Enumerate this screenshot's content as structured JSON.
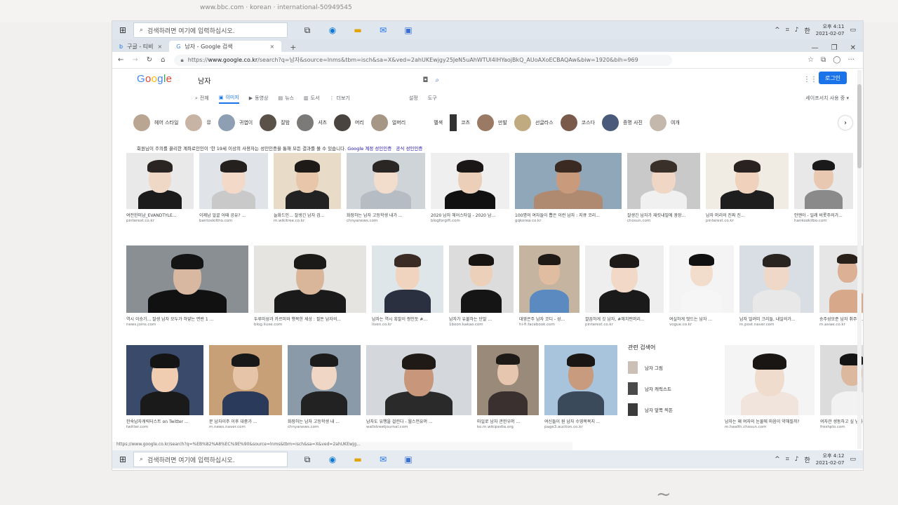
{
  "paper": {
    "snippet": "www.bbc.com · korean · international-50949545"
  },
  "taskbar": {
    "search_placeholder": "검색하려면 여기에 입력하십시오.",
    "ime": "한",
    "clock_time": "오후 4:11",
    "clock_date": "2021-02-07",
    "bottom_clock_time": "오후 4:12",
    "bottom_clock_date": "2021-02-07"
  },
  "browser": {
    "tabs": [
      {
        "label": "구글 - 티비"
      },
      {
        "label": "남자 - Google 검색"
      }
    ],
    "url_prefix": "https://",
    "url_domain": "www.google.co.kr",
    "url_rest": "/search?q=남자&source=lnms&tbm=isch&sa=X&ved=2ahUKEwjgy25JeN5uAhWTUl4IHYaojBkQ_AUoAXoECBAQAw&biw=1920&bih=969",
    "status_url": "https://www.google.co.kr/search?q=%EB%82%A8%EC%9E%90&source=lnms&tbm=isch&sa=X&ved=2ahUKEwjg..."
  },
  "google": {
    "logo": [
      "G",
      "o",
      "o",
      "g",
      "l",
      "e"
    ],
    "query": "남자",
    "login": "로그인",
    "nav": [
      "전체",
      "이미지",
      "동영상",
      "뉴스",
      "도서",
      "더보기"
    ],
    "tools_1": "설정",
    "tools_2": "도구",
    "safesearch": "세이프서치 사용 중 ▾"
  },
  "chips": [
    {
      "label": "헤어 스타일",
      "color": "#b9a592"
    },
    {
      "label": "뮤",
      "color": "#c8b4a4"
    },
    {
      "label": "귀엽이",
      "color": "#8e9fb4"
    },
    {
      "label": "잘밤",
      "color": "#5a5148"
    },
    {
      "label": "셔츠",
      "color": "#7c7a78"
    },
    {
      "label": "머리",
      "color": "#4a4440"
    },
    {
      "label": "얼머리",
      "color": "#a59686"
    },
    {
      "label": "멜색",
      "color": "#ffffff"
    },
    {
      "label": "코츠",
      "color": "#333333"
    },
    {
      "label": "만발",
      "color": "#9a7a64"
    },
    {
      "label": "선글라스",
      "color": "#c0aa80"
    },
    {
      "label": "코스다",
      "color": "#7a5a4a"
    },
    {
      "label": "증명 사진",
      "color": "#4a5a7a"
    },
    {
      "label": "여개",
      "color": "#c4b8ac"
    }
  ],
  "notice": {
    "text": "회원님이 주의를 끌리한 계좌로인인이 '한 19세 이상의 사용자는 성인인증을 통해 모든 결과를 볼 수 있습니다.",
    "link1": "Google 계정 성인인증",
    "link2": "공식 성인인증"
  },
  "images": [
    {
      "caption": "여전한미남_EVANDTYLE...",
      "source": "pinterest.co.kr",
      "bg": "#e9e9e9",
      "skin": "#f0d8c6",
      "hair": "#2a2522",
      "top": "#1c1c1c"
    },
    {
      "caption": "이제남 얼굴 어때 공유? ...",
      "source": "bantoskiltho.com",
      "bg": "#e0e4e8",
      "skin": "#f3d9c8",
      "hair": "#24201e",
      "top": "#c9c9c9"
    },
    {
      "caption": "늘화드인... 잘생긴 남자 검...",
      "source": "m.wikitree.co.kr",
      "bg": "#e8dcc8",
      "skin": "#e8c6aa",
      "hair": "#1e1a18",
      "top": "#222222"
    },
    {
      "caption": "화장하는 남자 고등학생 내가 ...",
      "source": "chnyanews.com",
      "bg": "#cfd4d8",
      "skin": "#f2dccc",
      "hair": "#2a2624",
      "top": "#b6bcc4"
    },
    {
      "caption": "2020 남자 헤어스타일 - 2020 남...",
      "source": "blogforgift.com",
      "bg": "#efefef",
      "skin": "#eccfb8",
      "hair": "#1a1716",
      "top": "#111111"
    },
    {
      "caption": "100명의 여자들이 뽑은 이런 남자 : 지큐 코리...",
      "source": "gqkorea.co.kr",
      "bg": "#8fa7b8",
      "skin": "#c99a7c",
      "hair": "#3a2a22",
      "top": "#b08a70"
    },
    {
      "caption": "잘생긴 남자가 재킷내밀에 광장...",
      "source": "chosun.com",
      "bg": "#c9c9c9",
      "skin": "#f0d6c4",
      "hair": "#3a302a",
      "top": "#f0f0f0"
    },
    {
      "caption": "남자 머리의 진짜 진...",
      "source": "pinterest.co.kr",
      "bg": "#f0ece4",
      "skin": "#f0d2bc",
      "hair": "#2a2220",
      "top": "#1e1e1e"
    },
    {
      "caption": "안엔아 - 일레 비롯주의가...",
      "source": "hankookilbo.com",
      "bg": "#e8e8e8",
      "skin": "#e8c8b0",
      "hair": "#1a1a1a",
      "top": "#8a8a8a"
    },
    {
      "caption": "역시 이승기... 잘생 남자 모두가 하얗는 면란 1 ...",
      "source": "news.joins.com",
      "bg": "#8a8f94",
      "skin": "#d8b8a0",
      "hair": "#141414",
      "top": "#111111"
    },
    {
      "caption": "두루미성과 카르미와 행복한 세상 : 필돈 남자의...",
      "source": "blog.iluxe.com",
      "bg": "#e6e4e0",
      "skin": "#d9b69a",
      "hair": "#1c1a18",
      "top": "#1a1a1a"
    },
    {
      "caption": "남자는 역시 흑발이 짱인듯 #...",
      "source": "liven.co.kr",
      "bg": "#dfe6ea",
      "skin": "#f0d4c0",
      "hair": "#3a2c24",
      "top": "#2a3040"
    },
    {
      "caption": "남자가 유불하는 단발 ...",
      "source": "1boon.kakao.com",
      "bg": "#dcdcdc",
      "skin": "#ecd0ba",
      "hair": "#181412",
      "top": "#151515"
    },
    {
      "caption": "대영은주 남자 코디 - 성...",
      "source": "hi-fi.facebook.com",
      "bg": "#c4b4a0",
      "skin": "#e0bca0",
      "hair": "#201a16",
      "top": "#5a8ac0"
    },
    {
      "caption": "깔끔하게 깃 남자, #헤치펀머리...",
      "source": "pinterest.co.kr",
      "bg": "#eeeeee",
      "skin": "#f2d8c6",
      "hair": "#1e1a18",
      "top": "#1a1a1a"
    },
    {
      "caption": "여실하게 멋드는 남자 ...",
      "source": "vogue.co.kr",
      "bg": "#f4f4f4",
      "skin": "#f2dccc",
      "hair": "#111111",
      "top": "#f6f6f6"
    },
    {
      "caption": "남자 얼려미 크리들, 내일의가...",
      "source": "m.post.naver.com",
      "bg": "#d8dee4",
      "skin": "#f0d8c8",
      "hair": "#2a2420",
      "top": "#e8e8e8"
    },
    {
      "caption": "송주성모준 남자 취주지...",
      "source": "m.asiae.co.kr",
      "bg": "#e6e6e6",
      "skin": "#dcb094",
      "hair": "#2a201a",
      "top": "#d8a88a"
    },
    {
      "caption": "한숙남자캐릭터스트 on Twitter ...",
      "source": "twitter.com",
      "bg": "#3a4a6a",
      "skin": "#f0ccb0",
      "hair": "#141414",
      "top": "#1a1a1a"
    },
    {
      "caption": "문 남자이주 이후 대중가 ...",
      "source": "m.news.naver.com",
      "bg": "#c8a078",
      "skin": "#e6c4a8",
      "hair": "#181818",
      "top": "#2a3a5a"
    },
    {
      "caption": "화장하는 남자 고등학생 내 ...",
      "source": "chnyanews.com",
      "bg": "#8a9aa8",
      "skin": "#f0d6c4",
      "hair": "#1c1c1c",
      "top": "#222222"
    },
    {
      "caption": "남자도 유행을 걸린다 - 월스먼유머 ...",
      "source": "wallstreetjournal.com",
      "bg": "#d4d8dc",
      "skin": "#c8967a",
      "hair": "#201a16",
      "top": "#2a2a2a"
    },
    {
      "caption": "마일로 남자 관한우머 ...",
      "source": "ko.m.wikipedia.org",
      "bg": "#9a8a7a",
      "skin": "#e6c6ae",
      "hair": "#1e1a18",
      "top": "#3a3030"
    },
    {
      "caption": "여신들이 원 남자 수영복목지 ...",
      "source": "page3.auction.co.kr",
      "bg": "#a8c4dc",
      "skin": "#c89a7e",
      "hair": "#1a1614",
      "top": "#3a4a5a"
    },
    {
      "caption": "남자는 왜 여자의 눈물에 마음이 약해질까?",
      "source": "m.health.chosun.com",
      "bg": "#f4f4f4",
      "skin": "#f0dccc",
      "hair": "#1a1614",
      "top": "#f0e4dc"
    },
    {
      "caption": "여자관 생동하고 싶 남자는 ...",
      "source": "freshplo.com",
      "bg": "#dcdcdc",
      "skin": "#dcb89e",
      "hair": "#141414",
      "top": "#f2f2f2"
    }
  ],
  "related": {
    "title": "관련 검색어",
    "items": [
      {
        "label": "남자 그림"
      },
      {
        "label": "남자 캐릭스트"
      },
      {
        "label": "남자 앞쪽 찍돈"
      }
    ]
  }
}
